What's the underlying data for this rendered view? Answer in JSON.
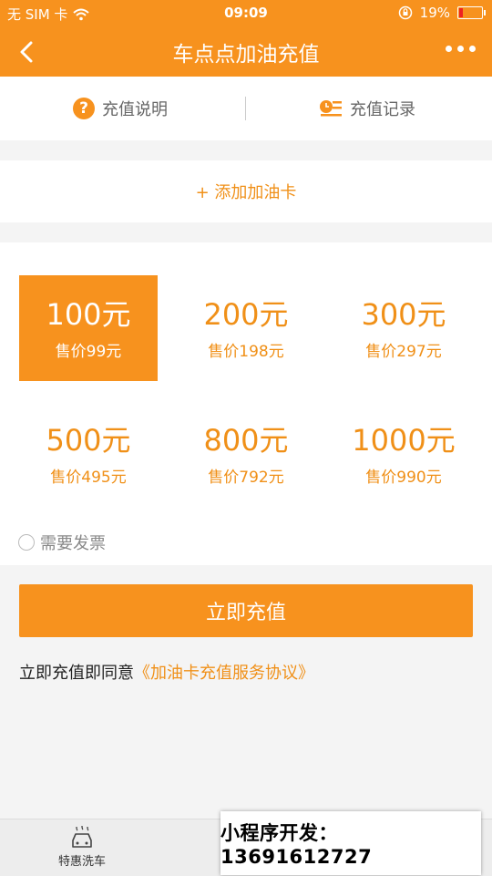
{
  "status_bar": {
    "carrier": "无 SIM 卡",
    "time": "09:09",
    "battery": "19%"
  },
  "nav": {
    "title": "车点点加油充值"
  },
  "tabs": {
    "instructions": "充值说明",
    "records": "充值记录"
  },
  "add_card": {
    "label": "+ 添加加油卡"
  },
  "amounts": [
    {
      "face": "100元",
      "price": "售价99元",
      "selected": true
    },
    {
      "face": "200元",
      "price": "售价198元",
      "selected": false
    },
    {
      "face": "300元",
      "price": "售价297元",
      "selected": false
    },
    {
      "face": "500元",
      "price": "售价495元",
      "selected": false
    },
    {
      "face": "800元",
      "price": "售价792元",
      "selected": false
    },
    {
      "face": "1000元",
      "price": "售价990元",
      "selected": false
    }
  ],
  "invoice": {
    "label": "需要发票"
  },
  "recharge_button": {
    "label": "立即充值"
  },
  "agreement": {
    "prefix": "立即充值即同意",
    "link": "《加油卡充值服务协议》"
  },
  "bottom_nav": {
    "car_wash": "特惠洗车"
  },
  "promo": {
    "text": "小程序开发：13691612727"
  },
  "colors": {
    "accent": "#f7921e",
    "accent_text": "#f09018"
  },
  "icons": {
    "back": "back-arrow-icon",
    "more": "more-dots-icon",
    "question": "question-icon",
    "records": "records-icon",
    "wifi": "wifi-icon",
    "lock": "rotation-lock-icon",
    "car_wash": "car-wash-icon"
  }
}
